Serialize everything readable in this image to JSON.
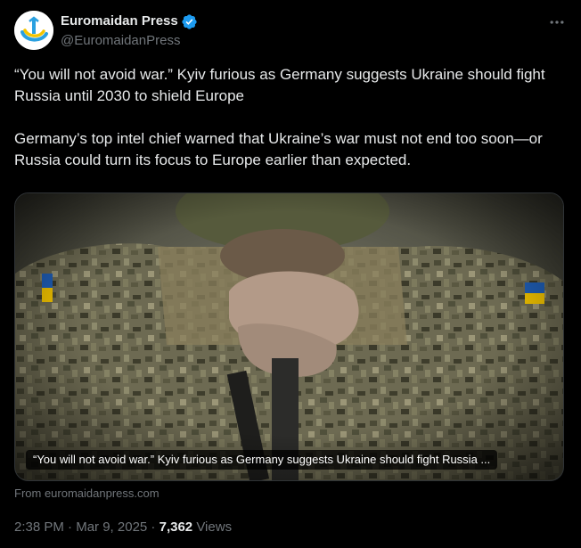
{
  "author": {
    "display_name": "Euromaidan Press",
    "handle": "@EuromaidanPress",
    "verified": true,
    "avatar_icon": "euromaidan-logo-icon",
    "verified_icon": "verified-badge-icon",
    "verified_color": "#1d9bf0"
  },
  "menu": {
    "icon": "more-dots-icon"
  },
  "tweet": {
    "paragraph_1": "“You will not avoid war.” Kyiv furious as Germany suggests Ukraine should fight Russia until 2030 to shield Europe",
    "paragraph_2": "Germany’s top intel chief warned that Ukraine’s war must not end too soon—or Russia could turn its focus to Europe earlier than expected."
  },
  "card": {
    "caption": "“You will not avoid war.” Kyiv furious as Germany suggests Ukraine should fight Russia ...",
    "source": "From euromaidanpress.com"
  },
  "meta": {
    "time": "2:38 PM",
    "separator_1": " · ",
    "date": "Mar 9, 2025",
    "separator_2": " · ",
    "views_count": "7,362",
    "views_label": " Views"
  },
  "colors": {
    "background": "#000000",
    "text_primary": "#e7e9ea",
    "text_secondary": "#71767b",
    "border": "#2f3336",
    "accent": "#1d9bf0"
  }
}
